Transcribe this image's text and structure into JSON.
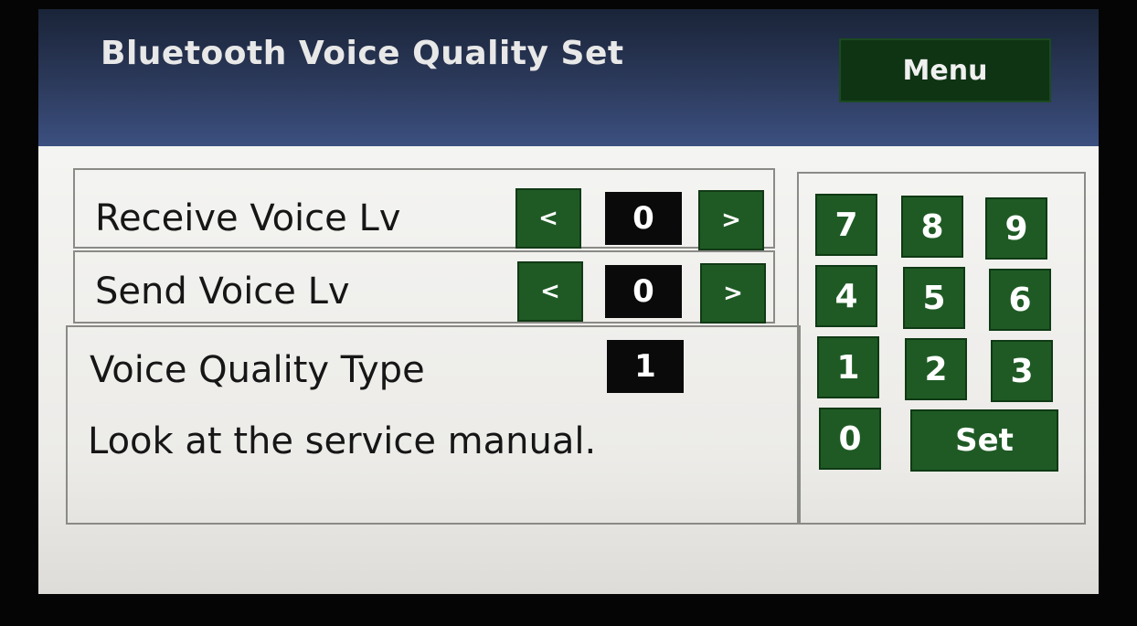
{
  "header": {
    "title": "Bluetooth Voice Quality Set",
    "menu_label": "Menu"
  },
  "settings": {
    "receive": {
      "label": "Receive Voice Lv",
      "value": "0",
      "dec": "<",
      "inc": ">"
    },
    "send": {
      "label": "Send Voice Lv",
      "value": "0",
      "dec": "<",
      "inc": ">"
    },
    "quality_type": {
      "label": "Voice Quality Type",
      "value": "1"
    },
    "note": "Look at the service manual."
  },
  "keypad": {
    "keys": [
      "7",
      "8",
      "9",
      "4",
      "5",
      "6",
      "1",
      "2",
      "3",
      "0"
    ],
    "set_label": "Set"
  },
  "colors": {
    "button_green": "#1f5a25",
    "header_blue": "#2c3a5c",
    "value_black": "#0a0a0a"
  }
}
